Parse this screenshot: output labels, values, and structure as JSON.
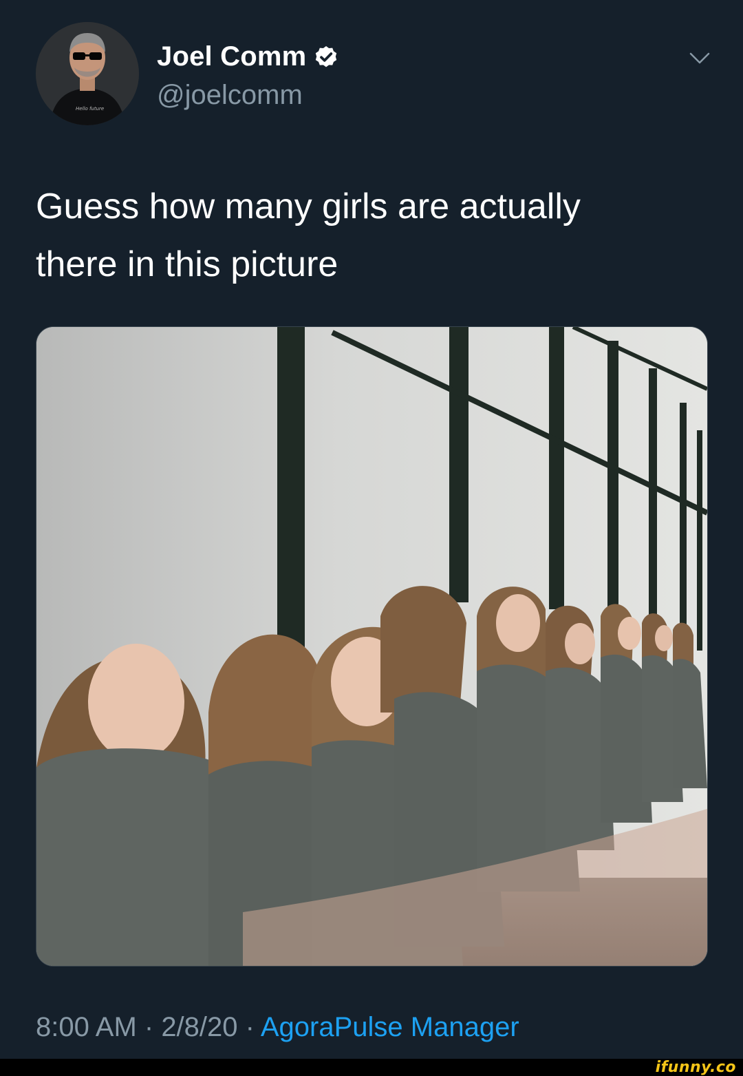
{
  "tweet": {
    "author": {
      "display_name": "Joel Comm",
      "handle": "@joelcomm",
      "avatar_icon": "avatar-photo",
      "verified_icon": "verified-badge-icon"
    },
    "menu_icon": "chevron-down-icon",
    "text_line1": "Guess how many girls are actually",
    "text_line2": "there in this picture",
    "media_icon": "photo",
    "meta": {
      "time": "8:00 AM",
      "separator1": " · ",
      "date": "2/8/20",
      "separator2": " · ",
      "source": "AgoraPulse Manager"
    }
  },
  "watermark": "ifunny.co",
  "colors": {
    "background": "#15202b",
    "primary_text": "#ffffff",
    "secondary_text": "#8899a6",
    "link": "#1da1f2",
    "watermark": "#f5c518"
  }
}
